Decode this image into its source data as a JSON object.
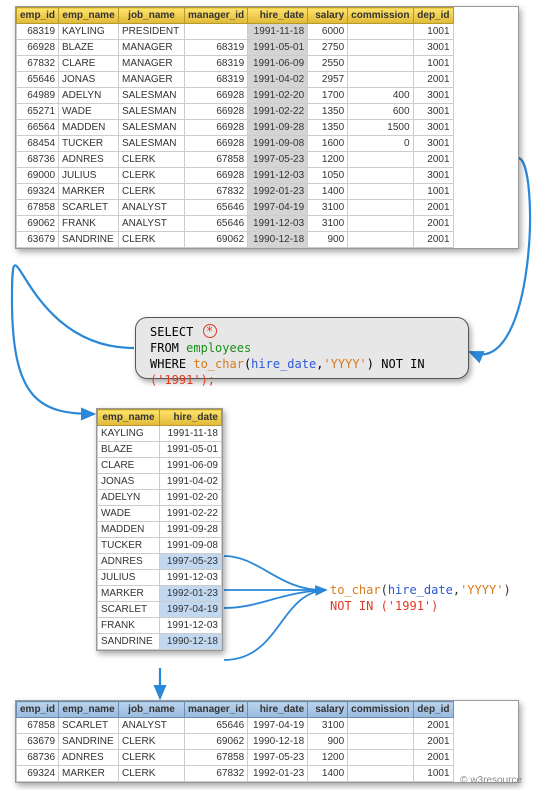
{
  "columns": [
    "emp_id",
    "emp_name",
    "job_name",
    "manager_id",
    "hire_date",
    "salary",
    "commission",
    "dep_id"
  ],
  "employees": [
    {
      "emp_id": 68319,
      "emp_name": "KAYLING",
      "job_name": "PRESIDENT",
      "manager_id": "",
      "hire_date": "1991-11-18",
      "salary": 6000,
      "commission": "",
      "dep_id": 1001
    },
    {
      "emp_id": 66928,
      "emp_name": "BLAZE",
      "job_name": "MANAGER",
      "manager_id": 68319,
      "hire_date": "1991-05-01",
      "salary": 2750,
      "commission": "",
      "dep_id": 3001
    },
    {
      "emp_id": 67832,
      "emp_name": "CLARE",
      "job_name": "MANAGER",
      "manager_id": 68319,
      "hire_date": "1991-06-09",
      "salary": 2550,
      "commission": "",
      "dep_id": 1001
    },
    {
      "emp_id": 65646,
      "emp_name": "JONAS",
      "job_name": "MANAGER",
      "manager_id": 68319,
      "hire_date": "1991-04-02",
      "salary": 2957,
      "commission": "",
      "dep_id": 2001
    },
    {
      "emp_id": 64989,
      "emp_name": "ADELYN",
      "job_name": "SALESMAN",
      "manager_id": 66928,
      "hire_date": "1991-02-20",
      "salary": 1700,
      "commission": 400,
      "dep_id": 3001
    },
    {
      "emp_id": 65271,
      "emp_name": "WADE",
      "job_name": "SALESMAN",
      "manager_id": 66928,
      "hire_date": "1991-02-22",
      "salary": 1350,
      "commission": 600,
      "dep_id": 3001
    },
    {
      "emp_id": 66564,
      "emp_name": "MADDEN",
      "job_name": "SALESMAN",
      "manager_id": 66928,
      "hire_date": "1991-09-28",
      "salary": 1350,
      "commission": 1500,
      "dep_id": 3001
    },
    {
      "emp_id": 68454,
      "emp_name": "TUCKER",
      "job_name": "SALESMAN",
      "manager_id": 66928,
      "hire_date": "1991-09-08",
      "salary": 1600,
      "commission": 0,
      "dep_id": 3001
    },
    {
      "emp_id": 68736,
      "emp_name": "ADNRES",
      "job_name": "CLERK",
      "manager_id": 67858,
      "hire_date": "1997-05-23",
      "salary": 1200,
      "commission": "",
      "dep_id": 2001
    },
    {
      "emp_id": 69000,
      "emp_name": "JULIUS",
      "job_name": "CLERK",
      "manager_id": 66928,
      "hire_date": "1991-12-03",
      "salary": 1050,
      "commission": "",
      "dep_id": 3001
    },
    {
      "emp_id": 69324,
      "emp_name": "MARKER",
      "job_name": "CLERK",
      "manager_id": 67832,
      "hire_date": "1992-01-23",
      "salary": 1400,
      "commission": "",
      "dep_id": 1001
    },
    {
      "emp_id": 67858,
      "emp_name": "SCARLET",
      "job_name": "ANALYST",
      "manager_id": 65646,
      "hire_date": "1997-04-19",
      "salary": 3100,
      "commission": "",
      "dep_id": 2001
    },
    {
      "emp_id": 69062,
      "emp_name": "FRANK",
      "job_name": "ANALYST",
      "manager_id": 65646,
      "hire_date": "1991-12-03",
      "salary": 3100,
      "commission": "",
      "dep_id": 2001
    },
    {
      "emp_id": 63679,
      "emp_name": "SANDRINE",
      "job_name": "CLERK",
      "manager_id": 69062,
      "hire_date": "1990-12-18",
      "salary": 900,
      "commission": "",
      "dep_id": 2001
    }
  ],
  "mid_columns": [
    "emp_name",
    "hire_date"
  ],
  "mid_rows": [
    {
      "emp_name": "KAYLING",
      "hire_date": "1991-11-18",
      "highlight": false
    },
    {
      "emp_name": "BLAZE",
      "hire_date": "1991-05-01",
      "highlight": false
    },
    {
      "emp_name": "CLARE",
      "hire_date": "1991-06-09",
      "highlight": false
    },
    {
      "emp_name": "JONAS",
      "hire_date": "1991-04-02",
      "highlight": false
    },
    {
      "emp_name": "ADELYN",
      "hire_date": "1991-02-20",
      "highlight": false
    },
    {
      "emp_name": "WADE",
      "hire_date": "1991-02-22",
      "highlight": false
    },
    {
      "emp_name": "MADDEN",
      "hire_date": "1991-09-28",
      "highlight": false
    },
    {
      "emp_name": "TUCKER",
      "hire_date": "1991-09-08",
      "highlight": false
    },
    {
      "emp_name": "ADNRES",
      "hire_date": "1997-05-23",
      "highlight": true
    },
    {
      "emp_name": "JULIUS",
      "hire_date": "1991-12-03",
      "highlight": false
    },
    {
      "emp_name": "MARKER",
      "hire_date": "1992-01-23",
      "highlight": true
    },
    {
      "emp_name": "SCARLET",
      "hire_date": "1997-04-19",
      "highlight": true
    },
    {
      "emp_name": "FRANK",
      "hire_date": "1991-12-03",
      "highlight": false
    },
    {
      "emp_name": "SANDRINE",
      "hire_date": "1990-12-18",
      "highlight": true
    }
  ],
  "result": [
    {
      "emp_id": 67858,
      "emp_name": "SCARLET",
      "job_name": "ANALYST",
      "manager_id": 65646,
      "hire_date": "1997-04-19",
      "salary": 3100,
      "commission": "",
      "dep_id": 2001
    },
    {
      "emp_id": 63679,
      "emp_name": "SANDRINE",
      "job_name": "CLERK",
      "manager_id": 69062,
      "hire_date": "1990-12-18",
      "salary": 900,
      "commission": "",
      "dep_id": 2001
    },
    {
      "emp_id": 68736,
      "emp_name": "ADNRES",
      "job_name": "CLERK",
      "manager_id": 67858,
      "hire_date": "1997-05-23",
      "salary": 1200,
      "commission": "",
      "dep_id": 2001
    },
    {
      "emp_id": 69324,
      "emp_name": "MARKER",
      "job_name": "CLERK",
      "manager_id": 67832,
      "hire_date": "1992-01-23",
      "salary": 1400,
      "commission": "",
      "dep_id": 1001
    }
  ],
  "sql": {
    "select": "SELECT",
    "star": "*",
    "from": "FROM",
    "table": "employees",
    "where": "WHERE",
    "fn": "to_char",
    "col": "hire_date",
    "arg": "'YYYY'",
    "notin": "NOT IN",
    "lit": "('1991');"
  },
  "annot": {
    "line1_fn": "to_char",
    "line1_col": "hire_date",
    "line1_arg": "'YYYY'",
    "line2": "NOT IN ('1991')"
  },
  "footer": "© w3resource"
}
